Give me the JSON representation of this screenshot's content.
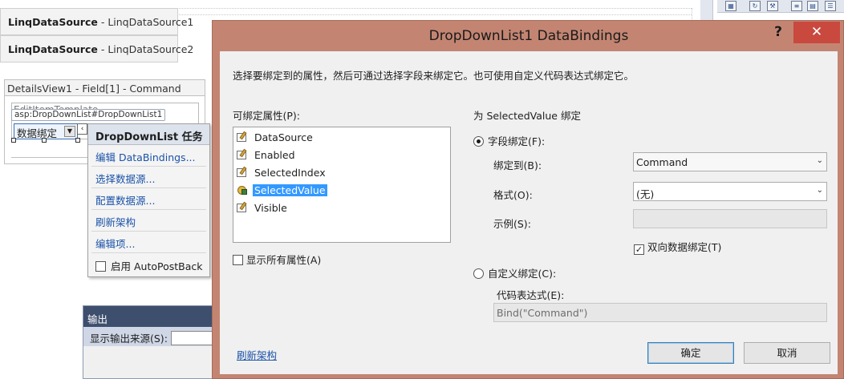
{
  "designer": {
    "datasource1": {
      "name": "LinqDataSource",
      "sub": " - LinqDataSource1"
    },
    "datasource2": {
      "name": "LinqDataSource",
      "sub": " - LinqDataSource2"
    },
    "detailsview_header": "DetailsView1 - Field[1] - Command",
    "edit_template_ghost": "EditItemTemplate",
    "asp_tag": "asp:DropDownList#DropDownList1",
    "dropdown_text": "数据绑定"
  },
  "tasks": {
    "title": "DropDownList 任务",
    "links": [
      "编辑 DataBindings...",
      "选择数据源...",
      "配置数据源...",
      "刷新架构",
      "编辑项..."
    ],
    "autopostback_label": "启用 AutoPostBack"
  },
  "output": {
    "title": "输出",
    "source_label": "显示输出来源(S):"
  },
  "dialog": {
    "title": "DropDownList1 DataBindings",
    "help": "?",
    "close": "✕",
    "description": "选择要绑定到的属性，然后可通过选择字段来绑定它。也可使用自定义代码表达式绑定它。",
    "bindable_label": "可绑定属性(P):",
    "properties": [
      {
        "name": "DataSource",
        "icon": "property-icon",
        "selected": false
      },
      {
        "name": "Enabled",
        "icon": "property-icon",
        "selected": false
      },
      {
        "name": "SelectedIndex",
        "icon": "property-icon",
        "selected": false
      },
      {
        "name": "SelectedValue",
        "icon": "bound-property-icon",
        "selected": true
      },
      {
        "name": "Visible",
        "icon": "property-icon",
        "selected": false
      }
    ],
    "show_all_label": "显示所有属性(A)",
    "binding_for": "为 SelectedValue 绑定",
    "field_binding_label": "字段绑定(F):",
    "bind_to_label": "绑定到(B):",
    "bind_to_value": "Command",
    "format_label": "格式(O):",
    "format_value": "(无)",
    "sample_label": "示例(S):",
    "two_way_label": "双向数据绑定(T)",
    "custom_binding_label": "自定义绑定(C):",
    "code_expr_label": "代码表达式(E):",
    "code_expr_value": "Bind(\"Command\")",
    "refresh_link": "刷新架构",
    "ok": "确定",
    "cancel": "取消"
  },
  "colors": {
    "title_bar": "#c38572",
    "close_button": "#c9493f",
    "selection": "#3399ff",
    "link": "#1a52a8"
  }
}
